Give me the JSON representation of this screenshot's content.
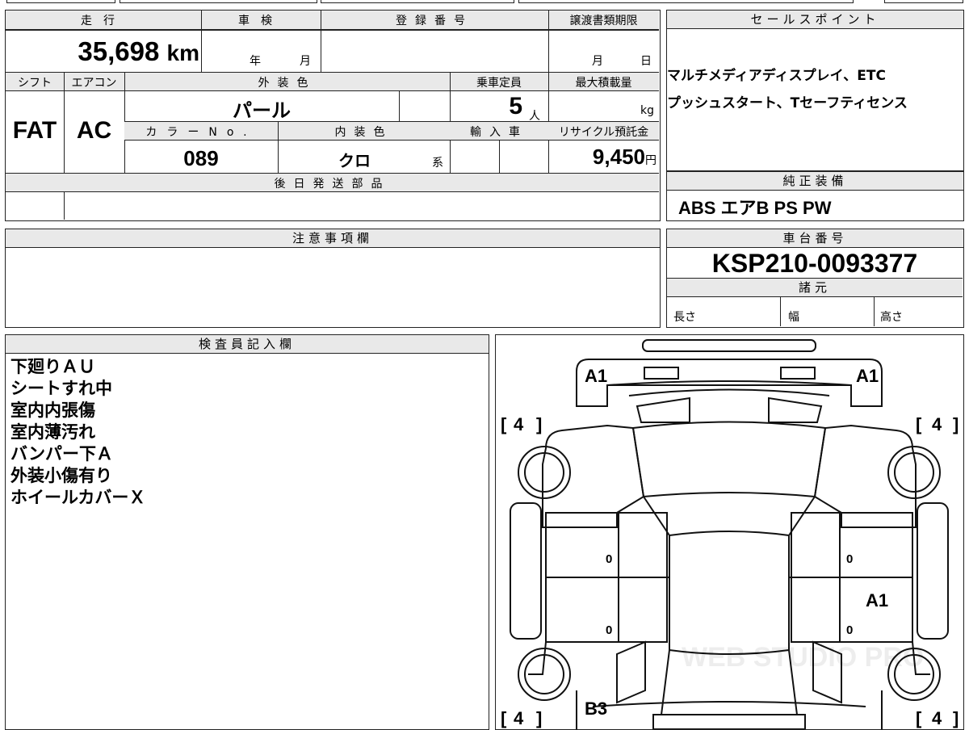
{
  "main_table": {
    "mileage_label": "走行",
    "mileage_value": "35,698",
    "mileage_unit": "km",
    "inspection_label": "車検",
    "inspection_year": "年",
    "inspection_month": "月",
    "registration_label": "登録番号",
    "transfer_label": "譲渡書類期限",
    "transfer_month": "月",
    "transfer_day": "日",
    "shift_label": "シフト",
    "shift_value": "FAT",
    "ac_label": "エアコン",
    "ac_value": "AC",
    "exterior_label": "外装色",
    "exterior_value": "パール",
    "capacity_label": "乗車定員",
    "capacity_value": "5",
    "capacity_unit": "人",
    "maxload_label": "最大積載量",
    "maxload_unit": "kg",
    "color_no_label": "カラーNo.",
    "color_no_value": "089",
    "interior_label": "内装色",
    "interior_value": "クロ",
    "interior_unit": "系",
    "import_label": "輸入車",
    "recycle_label": "リサイクル預託金",
    "recycle_value": "9,450",
    "recycle_unit": "円",
    "later_parts_label": "後日発送部品"
  },
  "sales_points": {
    "label": "セールスポイント",
    "lines": [
      "マルチメディアディスプレイ、ETC",
      "プッシュスタート、Tセーフティセンス"
    ]
  },
  "equipment": {
    "label": "純正装備",
    "value": "ABS エアB PS PW"
  },
  "notes": {
    "label": "注意事項欄"
  },
  "chassis": {
    "label": "車台番号",
    "value": "KSP210-0093377",
    "spec_label": "諸元",
    "length_label": "長さ",
    "width_label": "幅",
    "height_label": "高さ"
  },
  "inspector": {
    "label": "検査員記入欄",
    "lines": [
      "下廻りＡＵ",
      "シートすれ中",
      "室内内張傷",
      "室内薄汚れ",
      "バンパー下Ａ",
      "外装小傷有り",
      "ホイールカバーＸ"
    ]
  },
  "diagram": {
    "marks": {
      "front_left": "A1",
      "front_right": "A1",
      "right_rear_door": "A1",
      "rear_left": "B3"
    },
    "tires": {
      "front_left": "4",
      "front_right": "4",
      "rear_left": "4",
      "rear_right": "4"
    },
    "bracket_open": "[",
    "bracket_close": "]",
    "door_marks": [
      "0",
      "0",
      "0",
      "0"
    ],
    "watermark": "WEB STUDIO PRO"
  }
}
